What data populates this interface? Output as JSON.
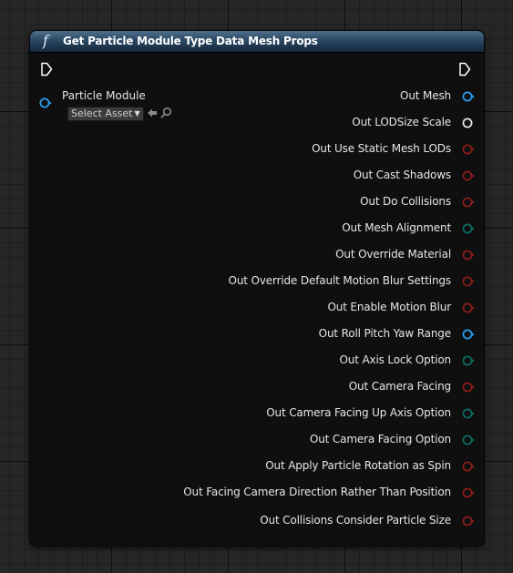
{
  "node": {
    "title": "Get Particle Module Type Data Mesh Props",
    "function_icon": "function-icon",
    "input": {
      "label": "Particle Module",
      "pin_color": "#2a9cf0",
      "asset_picker": {
        "value": "Select Asset",
        "use_icon": "arrow-left-icon",
        "browse_icon": "search-icon"
      }
    },
    "outputs": [
      {
        "label": "Out Mesh",
        "pin_type": "object",
        "color": "#2a9cf0"
      },
      {
        "label": "Out LODSize Scale",
        "pin_type": "float",
        "color": "#e6e6e6"
      },
      {
        "label": "Out Use Static Mesh LODs",
        "pin_type": "bool",
        "color": "#8a1c1c"
      },
      {
        "label": "Out Cast Shadows",
        "pin_type": "bool",
        "color": "#8a1c1c"
      },
      {
        "label": "Out Do Collisions",
        "pin_type": "bool",
        "color": "#8a1c1c"
      },
      {
        "label": "Out Mesh Alignment",
        "pin_type": "enum",
        "color": "#0b6b62"
      },
      {
        "label": "Out Override Material",
        "pin_type": "bool",
        "color": "#8a1c1c"
      },
      {
        "label": "Out Override Default Motion Blur Settings",
        "pin_type": "bool",
        "color": "#8a1c1c"
      },
      {
        "label": "Out Enable Motion Blur",
        "pin_type": "bool",
        "color": "#8a1c1c"
      },
      {
        "label": "Out Roll Pitch Yaw Range",
        "pin_type": "object",
        "color": "#2a9cf0"
      },
      {
        "label": "Out Axis Lock Option",
        "pin_type": "enum",
        "color": "#0b6b62"
      },
      {
        "label": "Out Camera Facing",
        "pin_type": "bool",
        "color": "#8a1c1c"
      },
      {
        "label": "Out Camera Facing Up Axis Option",
        "pin_type": "enum",
        "color": "#0b6b62"
      },
      {
        "label": "Out Camera Facing Option",
        "pin_type": "enum",
        "color": "#0b6b62"
      },
      {
        "label": "Out Apply Particle Rotation as Spin",
        "pin_type": "bool",
        "color": "#8a1c1c"
      },
      {
        "label": "Out Facing Camera Direction Rather Than Position",
        "pin_type": "bool",
        "color": "#8a1c1c"
      },
      {
        "label": "Out Collisions Consider Particle Size",
        "pin_type": "bool",
        "color": "#8a1c1c"
      }
    ]
  }
}
